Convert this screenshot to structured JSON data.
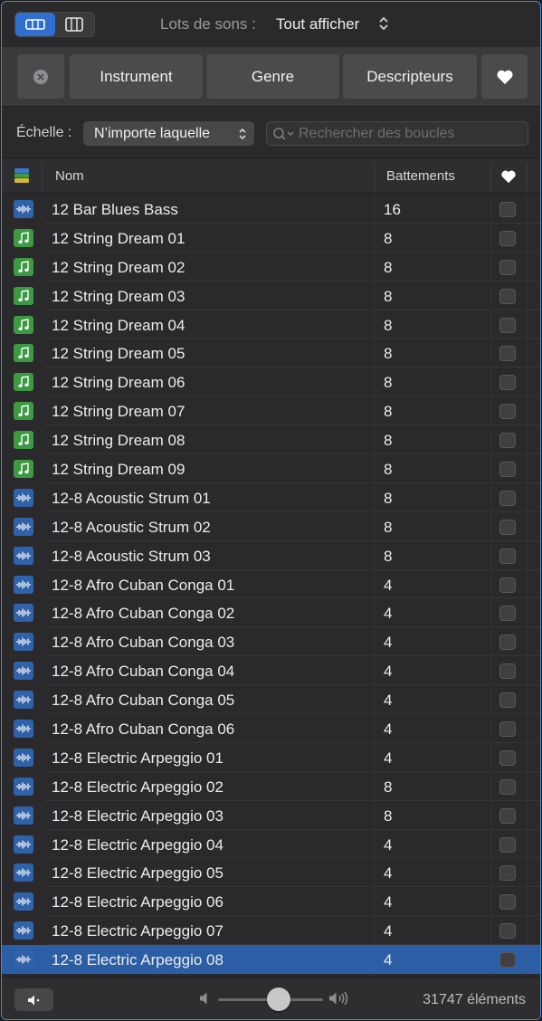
{
  "toolbar": {
    "packs_label": "Lots de sons :",
    "packs_value": "Tout afficher",
    "view_modes": [
      "button-view-icon",
      "column-view-icon"
    ]
  },
  "filters": {
    "instrument": "Instrument",
    "genre": "Genre",
    "descriptors": "Descripteurs"
  },
  "scale": {
    "label": "Échelle :",
    "value": "N’importe laquelle"
  },
  "search": {
    "placeholder": "Rechercher des boucles",
    "value": ""
  },
  "table": {
    "headers": {
      "name": "Nom",
      "beats": "Battements"
    },
    "rows": [
      {
        "type": "audio",
        "name": "12 Bar Blues Bass",
        "beats": "16"
      },
      {
        "type": "midi",
        "name": "12 String Dream 01",
        "beats": "8"
      },
      {
        "type": "midi",
        "name": "12 String Dream 02",
        "beats": "8"
      },
      {
        "type": "midi",
        "name": "12 String Dream 03",
        "beats": "8"
      },
      {
        "type": "midi",
        "name": "12 String Dream 04",
        "beats": "8"
      },
      {
        "type": "midi",
        "name": "12 String Dream 05",
        "beats": "8"
      },
      {
        "type": "midi",
        "name": "12 String Dream 06",
        "beats": "8"
      },
      {
        "type": "midi",
        "name": "12 String Dream 07",
        "beats": "8"
      },
      {
        "type": "midi",
        "name": "12 String Dream 08",
        "beats": "8"
      },
      {
        "type": "midi",
        "name": "12 String Dream 09",
        "beats": "8"
      },
      {
        "type": "audio",
        "name": "12-8 Acoustic Strum 01",
        "beats": "8"
      },
      {
        "type": "audio",
        "name": "12-8 Acoustic Strum 02",
        "beats": "8"
      },
      {
        "type": "audio",
        "name": "12-8 Acoustic Strum 03",
        "beats": "8"
      },
      {
        "type": "audio",
        "name": "12-8 Afro Cuban Conga 01",
        "beats": "4"
      },
      {
        "type": "audio",
        "name": "12-8 Afro Cuban Conga 02",
        "beats": "4"
      },
      {
        "type": "audio",
        "name": "12-8 Afro Cuban Conga 03",
        "beats": "4"
      },
      {
        "type": "audio",
        "name": "12-8 Afro Cuban Conga 04",
        "beats": "4"
      },
      {
        "type": "audio",
        "name": "12-8 Afro Cuban Conga 05",
        "beats": "4"
      },
      {
        "type": "audio",
        "name": "12-8 Afro Cuban Conga 06",
        "beats": "4"
      },
      {
        "type": "audio",
        "name": "12-8 Electric Arpeggio 01",
        "beats": "4"
      },
      {
        "type": "audio",
        "name": "12-8 Electric Arpeggio 02",
        "beats": "8"
      },
      {
        "type": "audio",
        "name": "12-8 Electric Arpeggio 03",
        "beats": "8"
      },
      {
        "type": "audio",
        "name": "12-8 Electric Arpeggio 04",
        "beats": "4"
      },
      {
        "type": "audio",
        "name": "12-8 Electric Arpeggio 05",
        "beats": "4"
      },
      {
        "type": "audio",
        "name": "12-8 Electric Arpeggio 06",
        "beats": "4"
      },
      {
        "type": "audio",
        "name": "12-8 Electric Arpeggio 07",
        "beats": "4"
      },
      {
        "type": "audio",
        "name": "12-8 Electric Arpeggio 08",
        "beats": "4",
        "selected": true
      }
    ]
  },
  "footer": {
    "volume_level": 0.58,
    "count": "31747 éléments"
  },
  "colors": {
    "accent": "#2f6fd0",
    "selection": "#2b5ea5",
    "audio_icon": "#2f62a8",
    "midi_icon": "#3b9a42"
  }
}
